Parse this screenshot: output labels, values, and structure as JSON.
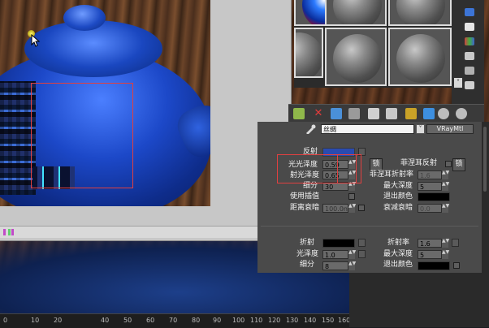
{
  "material": {
    "name": "丝绸",
    "type_button": "VRayMtl"
  },
  "reflection": {
    "title": "反射",
    "gloss_label": "光光泽度",
    "gloss_value": "0.59",
    "refl_gloss_label": "射光泽度",
    "refl_gloss_value": "0.65",
    "subdiv_label": "细分",
    "subdiv_value": "30",
    "interp_label": "使用插值",
    "dim_label": "距离衰暗",
    "dim_value": "100.0n",
    "lock_label": "锁",
    "fresnel_label": "菲涅耳反射",
    "fresnel_ior_label": "菲涅耳折射率",
    "fresnel_ior_value": "1.6",
    "max_depth_label": "最大深度",
    "max_depth_value": "5",
    "exit_color_label": "退出颜色",
    "dim_falloff_label": "衰减衰暗",
    "dim_falloff_value": "0.0"
  },
  "refraction": {
    "title": "折射",
    "ior_label": "折射率",
    "ior_value": "1.6",
    "gloss_label": "光泽度",
    "gloss_value": "1.0",
    "max_depth_label": "最大深度",
    "max_depth_value": "5",
    "subdiv_label": "细分",
    "subdiv_value": "8",
    "exit_color_label": "退出颜色"
  },
  "ruler": {
    "ticks": [
      "0",
      "10",
      "20",
      "40",
      "50",
      "60",
      "70",
      "80",
      "90",
      "100",
      "110",
      "120",
      "130",
      "140",
      "150",
      "160"
    ]
  },
  "colors": {
    "highlight": "#e04040",
    "reflect_swatch": "#2a4bb0",
    "panel_bg": "#4a4a4a"
  }
}
